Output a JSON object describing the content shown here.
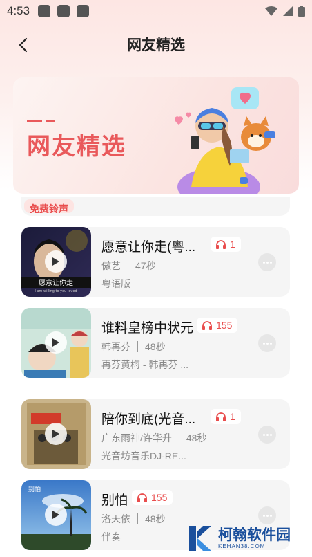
{
  "status_bar": {
    "time": "4:53"
  },
  "nav": {
    "title": "网友精选"
  },
  "banner": {
    "title": "网友精选"
  },
  "partial": {
    "tag": "免费铃声"
  },
  "colors": {
    "accent": "#e94d4d",
    "card_bg": "#f5f5f5",
    "banner_text": "#e9595b"
  },
  "songs": [
    {
      "title": "愿意让你走(粤...",
      "plays": "1",
      "artist": "傲艺",
      "duration": "47秒",
      "album": "粤语版"
    },
    {
      "title": "谁料皇榜中状元",
      "plays": "155",
      "artist": "韩再芬",
      "duration": "48秒",
      "album": "再芬黄梅 - 韩再芬 ..."
    },
    {
      "title": "陪你到底(光音...",
      "plays": "1",
      "artist": "广东雨神/许华升",
      "duration": "48秒",
      "album": "光音坊音乐DJ-RE..."
    },
    {
      "title": "别怕",
      "plays": "155",
      "artist": "洛天依",
      "duration": "48秒",
      "album": "伴奏"
    }
  ],
  "cover_texts": {
    "c1_main": "愿意让你走",
    "c1_sub": "I am willing to you loved",
    "c4_side": "别怕"
  },
  "watermark": {
    "name": "柯翰软件园",
    "url": "KEHAN38.COM"
  }
}
